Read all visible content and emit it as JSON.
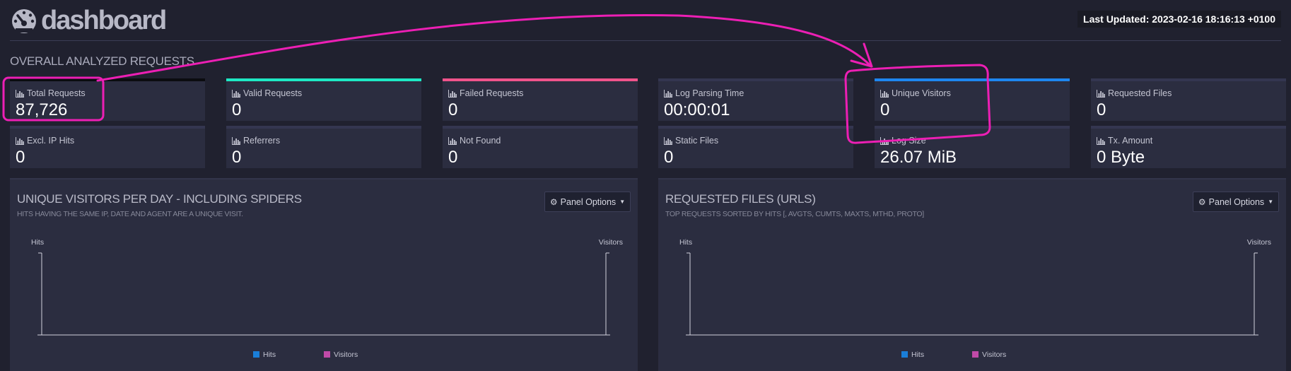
{
  "header": {
    "logo_text": "dashboard",
    "last_updated": "Last Updated: 2023-02-16 18:16:13 +0100"
  },
  "section_title": "OVERALL ANALYZED REQUESTS",
  "cards": [
    {
      "label": "Total Requests",
      "value": "87,726",
      "accent": "#0b0c10"
    },
    {
      "label": "Valid Requests",
      "value": "0",
      "accent": "#1ee8c4"
    },
    {
      "label": "Failed Requests",
      "value": "0",
      "accent": "#f0538b"
    },
    {
      "label": "Log Parsing Time",
      "value": "00:00:01",
      "accent": "#343650"
    },
    {
      "label": "Unique Visitors",
      "value": "0",
      "accent": "#1e86f0"
    },
    {
      "label": "Requested Files",
      "value": "0",
      "accent": "#343650"
    },
    {
      "label": "Excl. IP Hits",
      "value": "0",
      "accent": "#343650"
    },
    {
      "label": "Referrers",
      "value": "0",
      "accent": "#343650"
    },
    {
      "label": "Not Found",
      "value": "0",
      "accent": "#343650"
    },
    {
      "label": "Static Files",
      "value": "0",
      "accent": "#343650"
    },
    {
      "label": "Log Size",
      "value": "26.07 MiB",
      "accent": "#343650"
    },
    {
      "label": "Tx. Amount",
      "value": "0 Byte",
      "accent": "#343650"
    }
  ],
  "panels": [
    {
      "title": "UNIQUE VISITORS PER DAY - INCLUDING SPIDERS",
      "subtitle": "HITS HAVING THE SAME IP, DATE AND AGENT ARE A UNIQUE VISIT.",
      "button": "Panel Options",
      "y_left": "Hits",
      "y_right": "Visitors",
      "legend": [
        "Hits",
        "Visitors"
      ]
    },
    {
      "title": "REQUESTED FILES (URLS)",
      "subtitle": "TOP REQUESTS SORTED BY HITS [, AVGTS, CUMTS, MAXTS, MTHD, PROTO]",
      "button": "Panel Options",
      "y_left": "Hits",
      "y_right": "Visitors",
      "legend": [
        "Hits",
        "Visitors"
      ]
    }
  ],
  "colors": {
    "hits": "#1a7ed8",
    "visitors": "#c04aa8",
    "annotation": "#ec1fb4"
  }
}
